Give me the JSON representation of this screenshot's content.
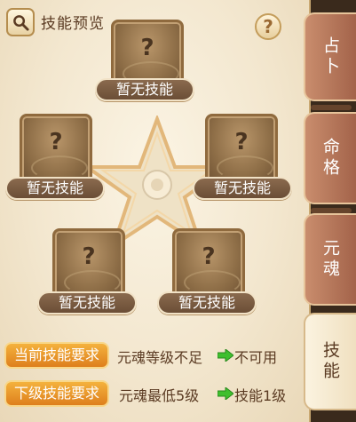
{
  "header": {
    "search_icon": "magnifier-icon",
    "title": "技能预览",
    "help_label": "?"
  },
  "slots": [
    {
      "label": "暂无技能",
      "placeholder": "?"
    },
    {
      "label": "暂无技能",
      "placeholder": "?"
    },
    {
      "label": "暂无技能",
      "placeholder": "?"
    },
    {
      "label": "暂无技能",
      "placeholder": "?"
    },
    {
      "label": "暂无技能",
      "placeholder": "?"
    }
  ],
  "requirements": {
    "current": {
      "badge": "当前技能要求",
      "condition": "元魂等级不足",
      "result": "不可用"
    },
    "next": {
      "badge": "下级技能要求",
      "condition": "元魂最低5级",
      "result": "技能1级"
    }
  },
  "tabs": [
    {
      "label": "占卜",
      "active": false
    },
    {
      "label": "命格",
      "active": false
    },
    {
      "label": "元魂",
      "active": false
    },
    {
      "label": "技能",
      "active": true
    }
  ],
  "colors": {
    "arrow_green": "#3fbf2e",
    "badge_orange": "#e8901f",
    "tab_brown": "#b5734f"
  }
}
